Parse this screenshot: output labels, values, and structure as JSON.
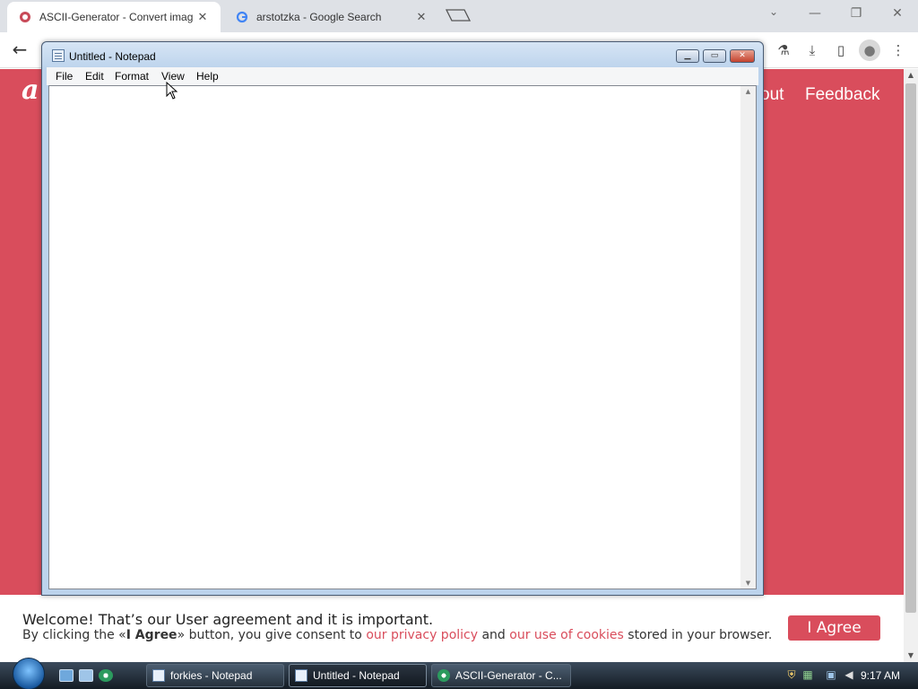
{
  "browser": {
    "tabs": [
      {
        "title": "ASCII-Generator - Convert imag",
        "active": true,
        "favicon": "ascii-generator-favicon"
      },
      {
        "title": "arstotzka - Google Search",
        "active": false,
        "favicon": "google-g-icon"
      }
    ],
    "close_glyph": "✕",
    "window_controls": {
      "minimize": "—",
      "restore": "❐",
      "close": "✕"
    },
    "tab_search_glyph": "⌄",
    "toolbar": {
      "back_glyph": "←",
      "icons": [
        "labs-flask-icon",
        "download-icon",
        "side-panel-icon",
        "profile-icon",
        "menu-kebab-icon"
      ],
      "glyphs": {
        "labs": "⚗",
        "download": "⤓",
        "side_panel": "▯",
        "profile": "●",
        "menu": "⋮"
      }
    }
  },
  "webpage": {
    "logo_letter": "a",
    "nav": {
      "about_fragment": "out",
      "feedback": "Feedback"
    },
    "accent_color": "#d94d5c",
    "cookie_banner": {
      "title": "Welcome! That’s our User agreement and it is important.",
      "text_prefix": "By clicking the «",
      "button_ref": "I Agree",
      "text_after_button": "» button, you give consent to ",
      "link_privacy": "our privacy policy",
      "text_and": " and ",
      "link_cookies": "our use of cookies",
      "text_suffix": " stored in your browser.",
      "agree_button": "I Agree"
    },
    "scroll_glyphs": {
      "up": "▲",
      "down": "▼"
    }
  },
  "notepad": {
    "title": "Untitled - Notepad",
    "buttons": {
      "minimize": "▁",
      "maximize": "▭",
      "close": "✕"
    },
    "menu": [
      "File",
      "Edit",
      "Format",
      "View",
      "Help"
    ],
    "content": "",
    "scroll_glyphs": {
      "up": "▲",
      "down": "▼"
    }
  },
  "taskbar": {
    "tasks": [
      {
        "label": "forkies - Notepad",
        "active": false
      },
      {
        "label": "Untitled - Notepad",
        "active": true
      },
      {
        "label": "ASCII-Generator - C...",
        "active": false
      }
    ],
    "clock": "9:17 AM"
  }
}
